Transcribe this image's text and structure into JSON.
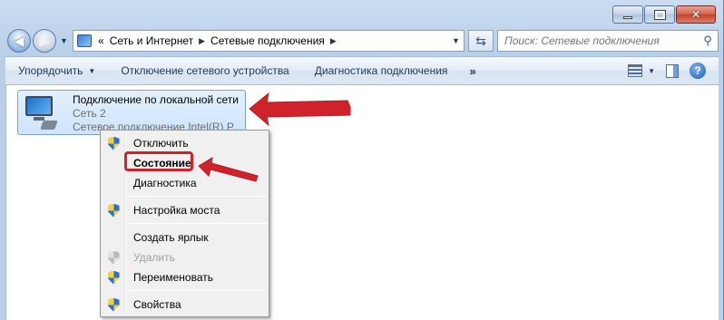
{
  "window": {
    "title_buttons": {
      "minimize": "minimize-icon",
      "maximize": "maximize-icon",
      "close": "✕"
    }
  },
  "navigation": {
    "breadcrumb": [
      "«",
      "Сеть и Интернет",
      "Сетевые подключения"
    ],
    "search_placeholder": "Поиск: Сетевые подключения"
  },
  "command_bar": {
    "organize": "Упорядочить",
    "disconnect": "Отключение сетевого устройства",
    "diagnose": "Диагностика подключения",
    "more": "»"
  },
  "connection": {
    "name": "Подключение по локальной сети",
    "network": "Сеть  2",
    "adapter": "Сетевое подключение Intel(R) P..."
  },
  "context_menu": {
    "items": [
      {
        "label": "Отключить",
        "icon": "shield-icon"
      },
      {
        "label": "Состояние",
        "icon": ""
      },
      {
        "label": "Диагностика",
        "icon": ""
      },
      {
        "label": "Настройка моста",
        "icon": "shield-icon"
      },
      {
        "label": "Создать ярлык",
        "icon": ""
      },
      {
        "label": "Удалить",
        "icon": "shield-icon-disabled"
      },
      {
        "label": "Переименовать",
        "icon": "shield-icon"
      },
      {
        "label": "Свойства",
        "icon": "shield-icon"
      }
    ]
  },
  "colors": {
    "annotation": "#d0222a",
    "selection": "#cde4fb"
  }
}
